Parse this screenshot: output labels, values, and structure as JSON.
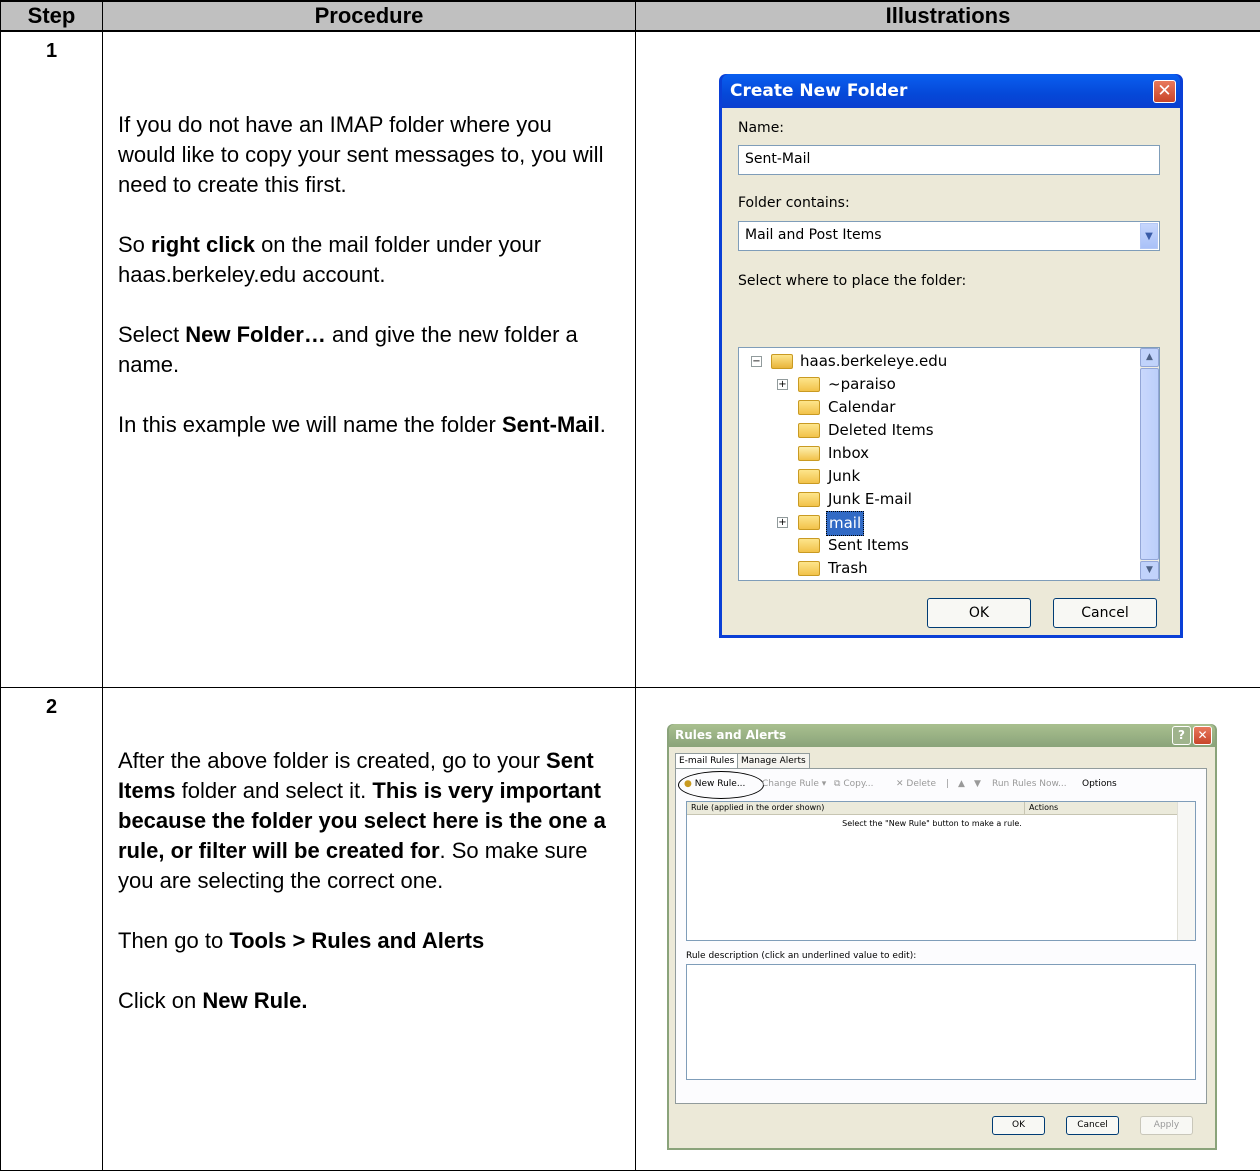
{
  "headers": {
    "step": "Step",
    "procedure": "Procedure",
    "illustrations": "Illustrations"
  },
  "rows": [
    {
      "step": "1",
      "paragraphs": [
        [
          {
            "t": "If you do not have an IMAP  folder  where you would like to copy your sent messages to, you will need to create this first.",
            "b": false
          }
        ],
        [
          {
            "t": "So ",
            "b": false
          },
          {
            "t": "right click",
            "b": true
          },
          {
            "t": " on the mail folder under your haas.berkeley.edu account.",
            "b": false
          }
        ],
        [
          {
            "t": "Select ",
            "b": false
          },
          {
            "t": "New Folder…",
            "b": true
          },
          {
            "t": " and give the new folder a name.",
            "b": false
          }
        ],
        [
          {
            "t": "In this example we will name the folder ",
            "b": false
          },
          {
            "t": "Sent-Mail",
            "b": true
          },
          {
            "t": ".",
            "b": false
          }
        ]
      ]
    },
    {
      "step": "2",
      "paragraphs": [
        [
          {
            "t": "After the above folder is created, go to your ",
            "b": false
          },
          {
            "t": "Sent Items",
            "b": true
          },
          {
            "t": " folder and select it.  ",
            "b": false
          },
          {
            "t": "This is very important because the folder you select here is the one a rule, or filter will be created for",
            "b": true
          },
          {
            "t": ". So make sure you are selecting the correct one.",
            "b": false
          }
        ],
        [
          {
            "t": "Then go to ",
            "b": false
          },
          {
            "t": "Tools > Rules and Alerts",
            "b": true
          }
        ],
        [
          {
            "t": "Click on ",
            "b": false
          },
          {
            "t": "New Rule.",
            "b": true
          }
        ]
      ]
    }
  ],
  "dialog1": {
    "title": "Create New Folder",
    "close_glyph": "✕",
    "name_label": "Name:",
    "name_value": "Sent-Mail",
    "contains_label": "Folder contains:",
    "contains_value": "Mail and Post Items",
    "place_label": "Select where to place the folder:",
    "tree": {
      "root": "haas.berkeleye.edu",
      "items": [
        "~paraiso",
        "Calendar",
        "Deleted Items",
        "Inbox",
        "Junk",
        "Junk E-mail",
        "mail",
        "Sent Items",
        "Trash"
      ]
    },
    "ok_label": "OK",
    "cancel_label": "Cancel"
  },
  "dialog2": {
    "title": "Rules and Alerts",
    "help_glyph": "?",
    "close_glyph": "✕",
    "tabs": [
      "E-mail Rules",
      "Manage Alerts"
    ],
    "toolbar": {
      "new_rule": "New Rule...",
      "change_rule": "Change Rule ▾",
      "copy": "Copy...",
      "delete": "Delete",
      "run_rules": "Run Rules Now...",
      "options": "Options"
    },
    "col_rule": "Rule (applied in the order shown)",
    "col_actions": "Actions",
    "empty_msg": "Select the \"New Rule\" button to make a rule.",
    "desc_label": "Rule description (click an underlined value to edit):",
    "ok_label": "OK",
    "cancel_label": "Cancel",
    "apply_label": "Apply"
  }
}
